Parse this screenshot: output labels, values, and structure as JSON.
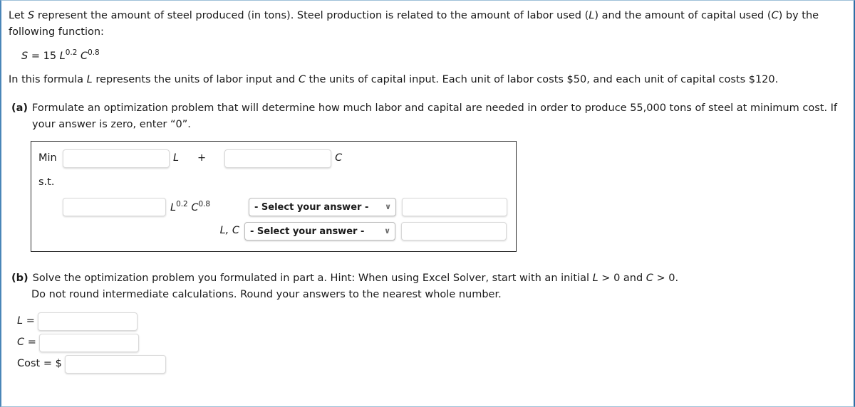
{
  "problem": {
    "intro_line1_a": "Let ",
    "intro_S": "S",
    "intro_line1_b": " represent the amount of steel produced (in tons). Steel production is related to the amount of labor used (",
    "intro_L": "L",
    "intro_line1_c": ") and the amount of capital used (",
    "intro_C": "C",
    "intro_line1_d": ") by the following function:",
    "formula": {
      "lhs": "S",
      "eq": "=",
      "coefficient": "15",
      "base_L": "L",
      "exp_L": "0.2",
      "base_C": "C",
      "exp_C": "0.8"
    },
    "intro_line2_a": "In this formula ",
    "intro_line2_L": "L",
    "intro_line2_b": " represents the units of labor input and ",
    "intro_line2_C": "C",
    "intro_line2_c": " the units of capital input. Each unit of labor costs $50, and each unit of capital costs $120."
  },
  "part_a": {
    "letter": "(a)",
    "text": "Formulate an optimization problem that will determine how much labor and capital are needed in order to produce 55,000 tons of steel at minimum cost. If your answer is zero, enter “0”.",
    "model": {
      "min_label": "Min",
      "st_label": "s.t.",
      "objective": {
        "coef_L_value": "",
        "coef_L_placeholder": "",
        "var_L": "L",
        "operator": "+",
        "coef_C_value": "",
        "coef_C_placeholder": "",
        "var_C": "C"
      },
      "constraint1": {
        "coef_value": "",
        "coef_placeholder": "",
        "term_base_L": "L",
        "term_exp_L": "0.2",
        "term_base_C": "C",
        "term_exp_C": "0.8",
        "select_label": "- Select your answer -",
        "select_chevron": "∨",
        "rhs_value": "",
        "rhs_placeholder": ""
      },
      "constraint2": {
        "vars_label": "L, C",
        "select_label": "- Select your answer -",
        "select_chevron": "∨",
        "rhs_value": "",
        "rhs_placeholder": ""
      }
    }
  },
  "part_b": {
    "letter": "(b)",
    "text_a": "Solve the optimization problem you formulated in part a. Hint: When using Excel Solver, start with an initial ",
    "text_L": "L",
    "text_b": " > 0 and ",
    "text_C": "C",
    "text_c": " > 0.",
    "text_line2": "Do not round intermediate calculations. Round your answers to the nearest whole number.",
    "answers": [
      {
        "label_var": "L",
        "label_eq": " =",
        "value": "",
        "placeholder": "",
        "prefix": ""
      },
      {
        "label_var": "C",
        "label_eq": " =",
        "value": "",
        "placeholder": "",
        "prefix": ""
      },
      {
        "label_var": "Cost",
        "label_eq": " = ",
        "value": "",
        "placeholder": "",
        "prefix": "$"
      }
    ]
  },
  "colors": {
    "frame_left": "#4a86b8",
    "frame_right": "#2e6da4",
    "box_border": "#2b2b2b",
    "input_border": "#d9d9d9",
    "text": "#1a1a1a"
  }
}
